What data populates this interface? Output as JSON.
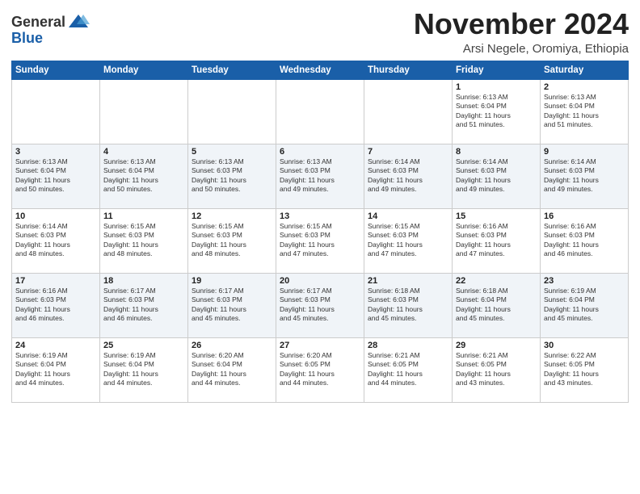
{
  "logo": {
    "general": "General",
    "blue": "Blue"
  },
  "header": {
    "month": "November 2024",
    "location": "Arsi Negele, Oromiya, Ethiopia"
  },
  "weekdays": [
    "Sunday",
    "Monday",
    "Tuesday",
    "Wednesday",
    "Thursday",
    "Friday",
    "Saturday"
  ],
  "weeks": [
    [
      {
        "day": "",
        "info": ""
      },
      {
        "day": "",
        "info": ""
      },
      {
        "day": "",
        "info": ""
      },
      {
        "day": "",
        "info": ""
      },
      {
        "day": "",
        "info": ""
      },
      {
        "day": "1",
        "info": "Sunrise: 6:13 AM\nSunset: 6:04 PM\nDaylight: 11 hours\nand 51 minutes."
      },
      {
        "day": "2",
        "info": "Sunrise: 6:13 AM\nSunset: 6:04 PM\nDaylight: 11 hours\nand 51 minutes."
      }
    ],
    [
      {
        "day": "3",
        "info": "Sunrise: 6:13 AM\nSunset: 6:04 PM\nDaylight: 11 hours\nand 50 minutes."
      },
      {
        "day": "4",
        "info": "Sunrise: 6:13 AM\nSunset: 6:04 PM\nDaylight: 11 hours\nand 50 minutes."
      },
      {
        "day": "5",
        "info": "Sunrise: 6:13 AM\nSunset: 6:03 PM\nDaylight: 11 hours\nand 50 minutes."
      },
      {
        "day": "6",
        "info": "Sunrise: 6:13 AM\nSunset: 6:03 PM\nDaylight: 11 hours\nand 49 minutes."
      },
      {
        "day": "7",
        "info": "Sunrise: 6:14 AM\nSunset: 6:03 PM\nDaylight: 11 hours\nand 49 minutes."
      },
      {
        "day": "8",
        "info": "Sunrise: 6:14 AM\nSunset: 6:03 PM\nDaylight: 11 hours\nand 49 minutes."
      },
      {
        "day": "9",
        "info": "Sunrise: 6:14 AM\nSunset: 6:03 PM\nDaylight: 11 hours\nand 49 minutes."
      }
    ],
    [
      {
        "day": "10",
        "info": "Sunrise: 6:14 AM\nSunset: 6:03 PM\nDaylight: 11 hours\nand 48 minutes."
      },
      {
        "day": "11",
        "info": "Sunrise: 6:15 AM\nSunset: 6:03 PM\nDaylight: 11 hours\nand 48 minutes."
      },
      {
        "day": "12",
        "info": "Sunrise: 6:15 AM\nSunset: 6:03 PM\nDaylight: 11 hours\nand 48 minutes."
      },
      {
        "day": "13",
        "info": "Sunrise: 6:15 AM\nSunset: 6:03 PM\nDaylight: 11 hours\nand 47 minutes."
      },
      {
        "day": "14",
        "info": "Sunrise: 6:15 AM\nSunset: 6:03 PM\nDaylight: 11 hours\nand 47 minutes."
      },
      {
        "day": "15",
        "info": "Sunrise: 6:16 AM\nSunset: 6:03 PM\nDaylight: 11 hours\nand 47 minutes."
      },
      {
        "day": "16",
        "info": "Sunrise: 6:16 AM\nSunset: 6:03 PM\nDaylight: 11 hours\nand 46 minutes."
      }
    ],
    [
      {
        "day": "17",
        "info": "Sunrise: 6:16 AM\nSunset: 6:03 PM\nDaylight: 11 hours\nand 46 minutes."
      },
      {
        "day": "18",
        "info": "Sunrise: 6:17 AM\nSunset: 6:03 PM\nDaylight: 11 hours\nand 46 minutes."
      },
      {
        "day": "19",
        "info": "Sunrise: 6:17 AM\nSunset: 6:03 PM\nDaylight: 11 hours\nand 45 minutes."
      },
      {
        "day": "20",
        "info": "Sunrise: 6:17 AM\nSunset: 6:03 PM\nDaylight: 11 hours\nand 45 minutes."
      },
      {
        "day": "21",
        "info": "Sunrise: 6:18 AM\nSunset: 6:03 PM\nDaylight: 11 hours\nand 45 minutes."
      },
      {
        "day": "22",
        "info": "Sunrise: 6:18 AM\nSunset: 6:04 PM\nDaylight: 11 hours\nand 45 minutes."
      },
      {
        "day": "23",
        "info": "Sunrise: 6:19 AM\nSunset: 6:04 PM\nDaylight: 11 hours\nand 45 minutes."
      }
    ],
    [
      {
        "day": "24",
        "info": "Sunrise: 6:19 AM\nSunset: 6:04 PM\nDaylight: 11 hours\nand 44 minutes."
      },
      {
        "day": "25",
        "info": "Sunrise: 6:19 AM\nSunset: 6:04 PM\nDaylight: 11 hours\nand 44 minutes."
      },
      {
        "day": "26",
        "info": "Sunrise: 6:20 AM\nSunset: 6:04 PM\nDaylight: 11 hours\nand 44 minutes."
      },
      {
        "day": "27",
        "info": "Sunrise: 6:20 AM\nSunset: 6:05 PM\nDaylight: 11 hours\nand 44 minutes."
      },
      {
        "day": "28",
        "info": "Sunrise: 6:21 AM\nSunset: 6:05 PM\nDaylight: 11 hours\nand 44 minutes."
      },
      {
        "day": "29",
        "info": "Sunrise: 6:21 AM\nSunset: 6:05 PM\nDaylight: 11 hours\nand 43 minutes."
      },
      {
        "day": "30",
        "info": "Sunrise: 6:22 AM\nSunset: 6:05 PM\nDaylight: 11 hours\nand 43 minutes."
      }
    ]
  ]
}
